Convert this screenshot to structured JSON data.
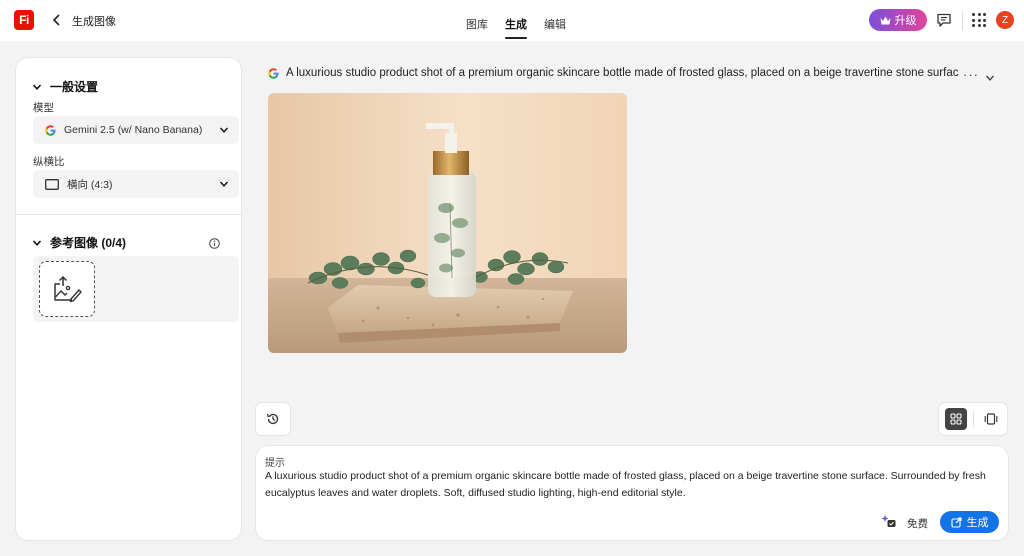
{
  "app": {
    "logo_text": "Fi",
    "page_title": "生成图像"
  },
  "nav": {
    "tabs": [
      {
        "label": "图库"
      },
      {
        "label": "生成"
      },
      {
        "label": "编辑"
      }
    ],
    "active_tab": "生成"
  },
  "header": {
    "upgrade_label": "升级",
    "avatar_initial": "Z"
  },
  "settings": {
    "general_title": "一般设置",
    "model_label": "模型",
    "model_value": "Gemini 2.5 (w/ Nano Banana)",
    "aspect_label": "纵横比",
    "aspect_value": "横向 (4:3)",
    "reference_title": "参考图像 (0/4)"
  },
  "result": {
    "prompt_preview": "A luxurious studio product shot of a premium organic skincare bottle made of frosted glass, placed on a beige travertine stone surface. Surrounded by fresh eucalyptus leaves and water droplets. Soft, diffused studio lighting, high-end editorial style.",
    "more_label": "···"
  },
  "composer": {
    "label": "提示",
    "text": "A luxurious studio product shot of a premium organic skincare bottle made of frosted glass, placed on a beige travertine stone surface. Surrounded by fresh eucalyptus leaves and water droplets. Soft, diffused studio lighting, high-end editorial style.",
    "cost_label": "免费",
    "generate_label": "生成"
  },
  "colors": {
    "brand": "#eb1000",
    "accent": "#1473e6",
    "upgrade_gradient_start": "#7b4fd8",
    "upgrade_gradient_end": "#e1449b",
    "avatar": "#e8421e"
  },
  "icons": [
    "back-arrow-icon",
    "crown-icon",
    "chat-icon",
    "apps-grid-icon",
    "chevron-down-icon",
    "google-icon",
    "rectangle-icon",
    "info-icon",
    "image-upload-icon",
    "history-icon",
    "grid-view-icon",
    "single-view-icon",
    "credits-icon",
    "generate-icon"
  ]
}
